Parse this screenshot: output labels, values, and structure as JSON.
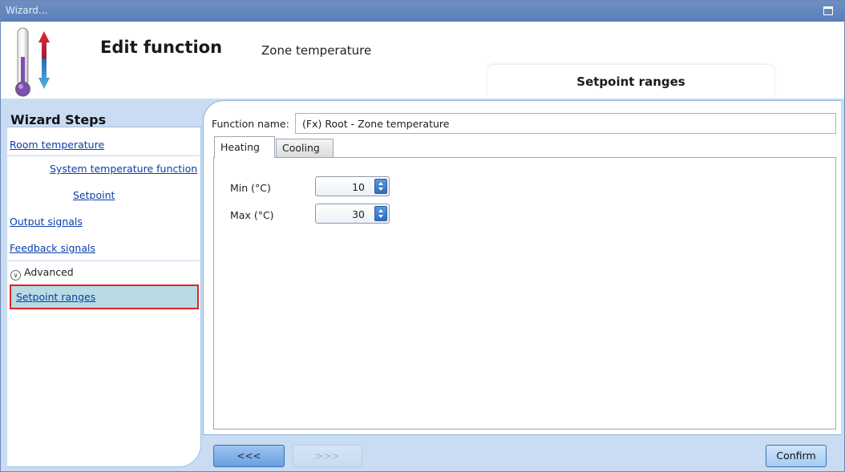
{
  "window": {
    "title": "Wizard..."
  },
  "header": {
    "title": "Edit function",
    "subtitle": "Zone temperature",
    "current_step": "Setpoint ranges"
  },
  "sidebar": {
    "title": "Wizard Steps",
    "steps": [
      {
        "label": "Room temperature"
      },
      {
        "label": "System temperature function"
      },
      {
        "label": "Setpoint"
      },
      {
        "label": "Output signals"
      },
      {
        "label": "Feedback signals"
      }
    ],
    "advanced_label": "Advanced",
    "selected_step": "Setpoint ranges"
  },
  "form": {
    "function_name_label": "Function name:",
    "function_name_value": "(Fx) Root - Zone temperature",
    "tabs": [
      {
        "label": "Heating",
        "active": true
      },
      {
        "label": "Cooling",
        "active": false
      }
    ],
    "min_label": "Min (°C)",
    "min_value": "10",
    "max_label": "Max (°C)",
    "max_value": "30"
  },
  "buttons": {
    "back": "<<<",
    "next": ">>>",
    "confirm": "Confirm"
  },
  "colors": {
    "title_bar": "#5a7fb9",
    "band": "#c9dcf2",
    "link": "#0a3ea8",
    "selection_border": "#e02424",
    "selection_fill": "#b8dbe5"
  }
}
